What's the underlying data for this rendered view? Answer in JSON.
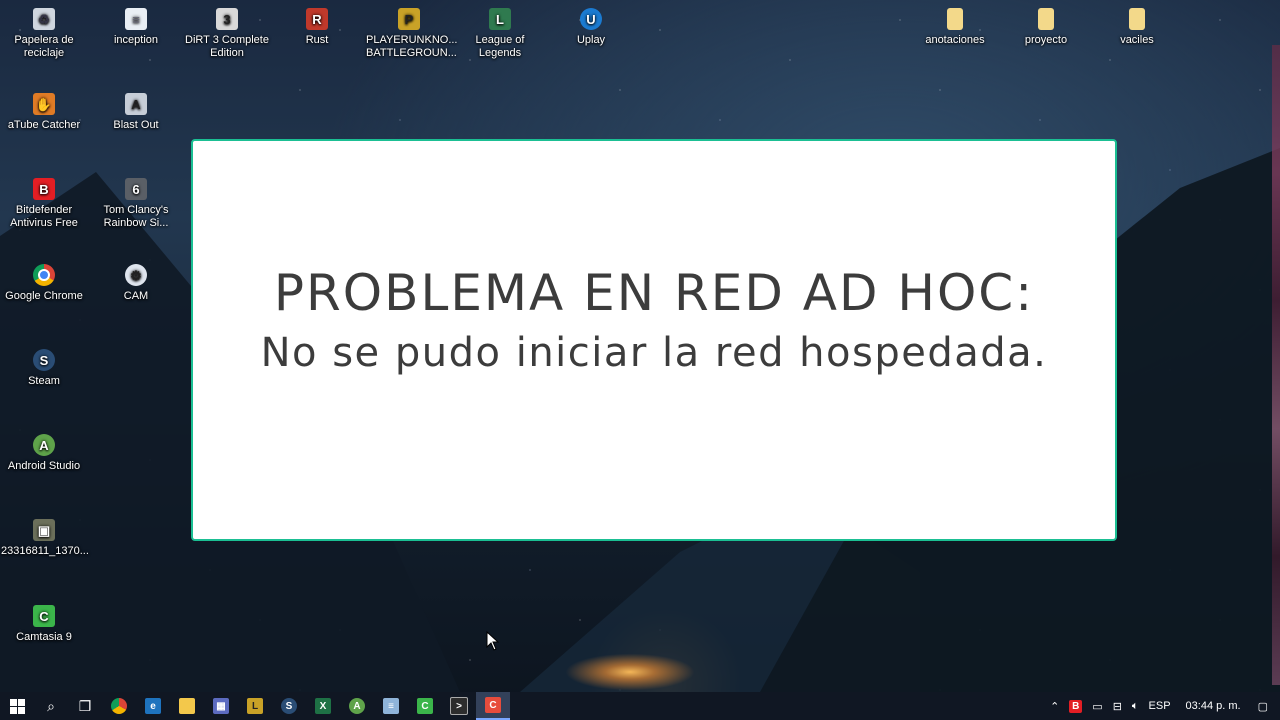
{
  "desktop": {
    "icons_left": [
      {
        "label": "Papelera de reciclaje",
        "icon": "recycle-bin-icon",
        "color": "#cfd6df"
      },
      {
        "label": "inception",
        "icon": "document-icon",
        "color": "#e9eef4"
      },
      {
        "label": "DiRT 3 Complete Edition",
        "icon": "dirt3-icon",
        "color": "#d9d9d9"
      },
      {
        "label": "Rust",
        "icon": "rust-icon",
        "color": "#c0392b"
      },
      {
        "label": "PLAYERUNKNO... BATTLEGROUN...",
        "icon": "pubg-icon",
        "color": "#c9a227"
      },
      {
        "label": "League of Legends",
        "icon": "lol-icon",
        "color": "#2f7a4f"
      },
      {
        "label": "Uplay",
        "icon": "uplay-icon",
        "color": "#1b7bd1"
      },
      {
        "label": "aTube Catcher",
        "icon": "atube-catcher-icon",
        "color": "#e07b25"
      },
      {
        "label": "Blast Out",
        "icon": "blast-out-icon",
        "color": "#c7ced8"
      },
      {
        "label": "Bitdefender Antivirus Free",
        "icon": "bitdefender-icon",
        "color": "#e31e24"
      },
      {
        "label": "Tom Clancy's Rainbow Si...",
        "icon": "rainbow-six-icon",
        "color": "#5a5f66"
      },
      {
        "label": "Google Chrome",
        "icon": "chrome-icon",
        "color": "#db4437"
      },
      {
        "label": "CAM",
        "icon": "cam-icon",
        "color": "#dfe5ee"
      },
      {
        "label": "Steam",
        "icon": "steam-icon",
        "color": "#2a4d75"
      },
      {
        "label": "Android Studio",
        "icon": "android-studio-icon",
        "color": "#5fa34a"
      },
      {
        "label": "23316811_1370...",
        "icon": "image-file-icon",
        "color": "#6b6f5a"
      },
      {
        "label": "Camtasia 9",
        "icon": "camtasia-icon",
        "color": "#3bb54a"
      }
    ],
    "icons_right": [
      {
        "label": "anotaciones",
        "icon": "folder-icon",
        "color": "#f3d98a"
      },
      {
        "label": "proyecto",
        "icon": "folder-icon",
        "color": "#f3d98a"
      },
      {
        "label": "vaciles",
        "icon": "folder-icon",
        "color": "#f3d98a"
      }
    ]
  },
  "overlay": {
    "title": "PROBLEMA EN RED AD HOC:",
    "subtitle": "No se pudo iniciar la red hospedada.",
    "border_color": "#1bbf93"
  },
  "taskbar": {
    "pinned": [
      {
        "name": "start-button",
        "icon": "windows-icon"
      },
      {
        "name": "search-button",
        "icon": "search-icon"
      },
      {
        "name": "task-view-button",
        "icon": "task-view-icon"
      },
      {
        "name": "taskbar-chrome",
        "icon": "chrome-icon",
        "color": "#db4437"
      },
      {
        "name": "taskbar-edge",
        "icon": "edge-icon",
        "color": "#1e73be"
      },
      {
        "name": "taskbar-explorer",
        "icon": "folder-icon",
        "color": "#f3c84b"
      },
      {
        "name": "taskbar-store",
        "icon": "store-icon",
        "color": "#5c6bc0"
      },
      {
        "name": "taskbar-lol",
        "icon": "lol-icon",
        "color": "#c9a227"
      },
      {
        "name": "taskbar-steam",
        "icon": "steam-icon",
        "color": "#2a4d75"
      },
      {
        "name": "taskbar-excel",
        "icon": "excel-icon",
        "color": "#1e7145"
      },
      {
        "name": "taskbar-android-studio",
        "icon": "android-studio-icon",
        "color": "#5fa34a"
      },
      {
        "name": "taskbar-notepad",
        "icon": "notepad-icon",
        "color": "#8fb4d9"
      },
      {
        "name": "taskbar-camtasia",
        "icon": "camtasia-icon",
        "color": "#3bb54a"
      },
      {
        "name": "taskbar-cmd",
        "icon": "cmd-icon",
        "color": "#2d2d2d"
      },
      {
        "name": "taskbar-camtasia-recorder",
        "icon": "camtasia-recorder-icon",
        "color": "#e74c3c",
        "active": true
      }
    ],
    "tray": {
      "language": "ESP",
      "time": "03:44 p. m."
    }
  }
}
